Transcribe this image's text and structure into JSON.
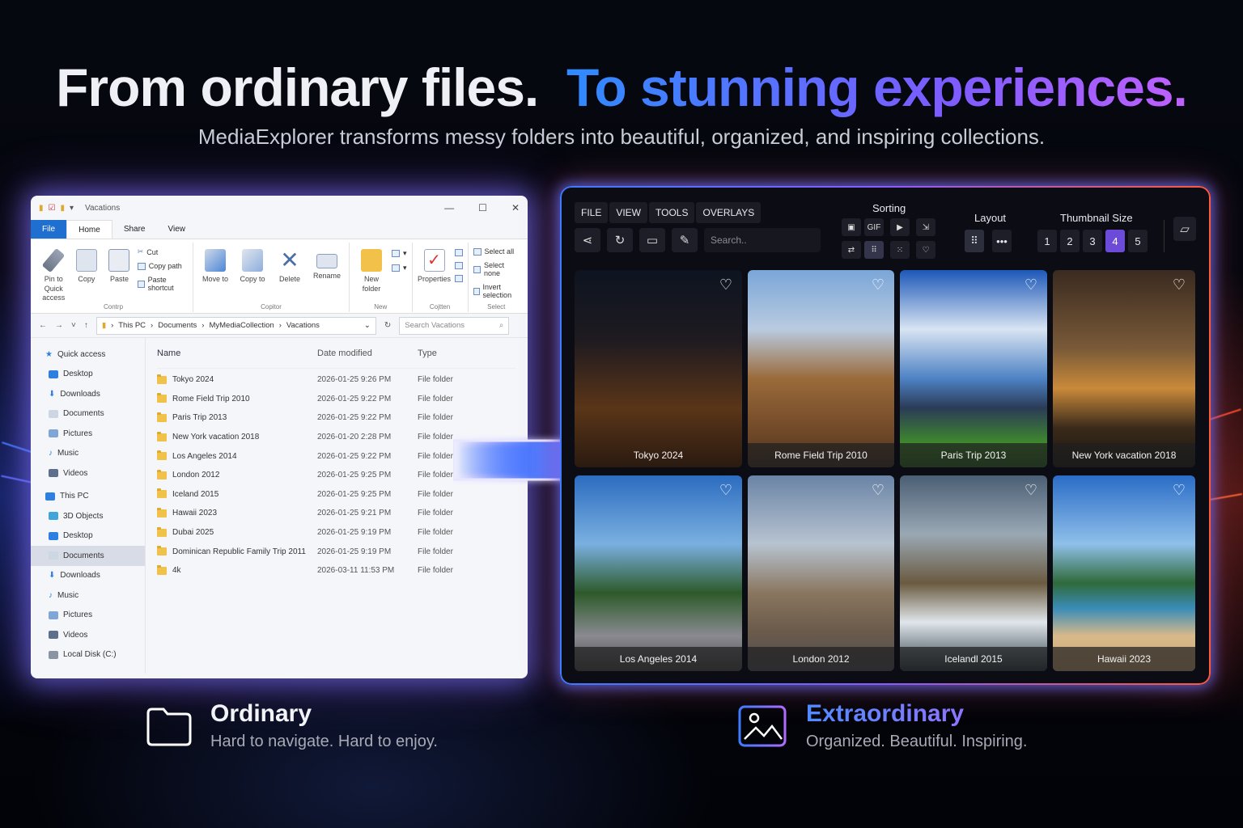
{
  "headline": {
    "part1": "From ordinary files.",
    "part2": "To stunning experiences."
  },
  "subtitle": "MediaExplorer transforms messy folders into beautiful, organized, and inspiring collections.",
  "explorer": {
    "title": "Vacations",
    "tabs": [
      "File",
      "Home",
      "Share",
      "View"
    ],
    "ribbon": {
      "pin": "Pin to Quick access",
      "copy": "Copy",
      "paste": "Paste",
      "cut": "Cut",
      "copy_path": "Copy path",
      "paste_shortcut": "Paste shortcut",
      "clipboard": "Contrp",
      "move_to": "Move to",
      "copy_to": "Copy to",
      "delete": "Delete",
      "rename": "Rename",
      "organize": "Copitor",
      "new_folder": "New folder",
      "new": "New",
      "properties": "Properties",
      "open": "Cojtten",
      "select_all": "Select all",
      "select_none": "Select none",
      "invert": "Invert selection",
      "select": "Select"
    },
    "crumbs": [
      "This PC",
      "Documents",
      "MyMediaCollection",
      "Vacations"
    ],
    "search_placeholder": "Search Vacations",
    "nav": [
      "Quick access",
      "Desktop",
      "Downloads",
      "Documents",
      "Pictures",
      "Music",
      "Videos",
      "This PC",
      "3D Objects",
      "Desktop",
      "Documents",
      "Downloads",
      "Music",
      "Pictures",
      "Videos",
      "Local Disk (C:)"
    ],
    "columns": [
      "Name",
      "Date modified",
      "Type"
    ],
    "rows": [
      {
        "name": "Tokyo 2024",
        "date": "2026-01-25 9:26 PM",
        "type": "File folder"
      },
      {
        "name": "Rome Field Trip 2010",
        "date": "2026-01-25 9:22 PM",
        "type": "File folder"
      },
      {
        "name": "Paris Trip 2013",
        "date": "2026-01-25 9:22 PM",
        "type": "File folder"
      },
      {
        "name": "New York vacation 2018",
        "date": "2026-01-20 2:28 PM",
        "type": "File folder"
      },
      {
        "name": "Los Angeles 2014",
        "date": "2026-01-25 9:22 PM",
        "type": "File folder"
      },
      {
        "name": "London 2012",
        "date": "2026-01-25 9:25 PM",
        "type": "File folder"
      },
      {
        "name": "Iceland 2015",
        "date": "2026-01-25 9:25 PM",
        "type": "File folder"
      },
      {
        "name": "Hawaii 2023",
        "date": "2026-01-25 9:21 PM",
        "type": "File folder"
      },
      {
        "name": "Dubai 2025",
        "date": "2026-01-25 9:19 PM",
        "type": "File folder"
      },
      {
        "name": "Dominican Republic Family Trip 2011",
        "date": "2026-01-25 9:19 PM",
        "type": "File folder"
      },
      {
        "name": "4k",
        "date": "2026-03-11 11:53 PM",
        "type": "File folder"
      }
    ]
  },
  "media": {
    "menus": [
      "FILE",
      "VIEW",
      "TOOLS",
      "OVERLAYS"
    ],
    "search_placeholder": "Search..",
    "sorting_label": "Sorting",
    "gif_label": "GIF",
    "layout_label": "Layout",
    "thumb_label": "Thumbnail Size",
    "sizes": [
      "1",
      "2",
      "3",
      "4",
      "5"
    ],
    "selected_size": "4",
    "tiles": [
      "Tokyo 2024",
      "Rome Field Trip 2010",
      "Paris Trip 2013",
      "New York vacation 2018",
      "Los Angeles 2014",
      "London 2012",
      "Icelandl 2015",
      "Hawaii 2023"
    ]
  },
  "ordinary": {
    "title": "Ordinary",
    "sub": "Hard to navigate. Hard to enjoy."
  },
  "extraordinary": {
    "title": "Extraordinary",
    "sub": "Organized. Beautiful. Inspiring."
  }
}
